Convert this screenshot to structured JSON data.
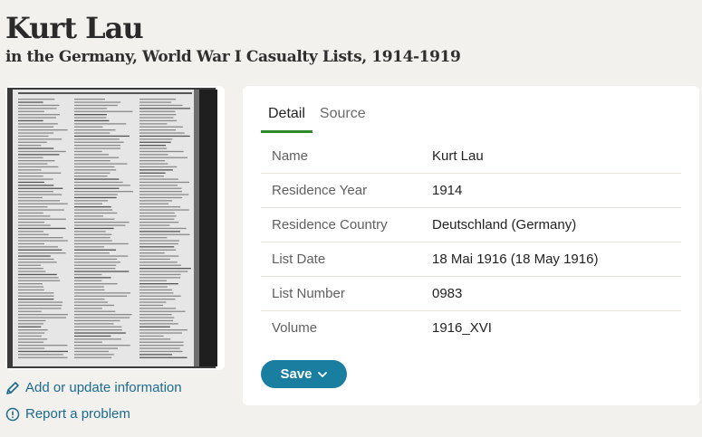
{
  "record": {
    "name": "Kurt Lau",
    "collection": "in the Germany, World War I Casualty Lists, 1914-1919"
  },
  "sidebar": {
    "add_update_label": "Add or update information",
    "report_label": "Report a problem"
  },
  "tabs": [
    {
      "label": "Detail",
      "active": true
    },
    {
      "label": "Source",
      "active": false
    }
  ],
  "details": [
    {
      "label": "Name",
      "value": "Kurt Lau"
    },
    {
      "label": "Residence Year",
      "value": "1914"
    },
    {
      "label": "Residence Country",
      "value": "Deutschland (Germany)"
    },
    {
      "label": "List Date",
      "value": "18 Mai 1916 (18 May 1916)"
    },
    {
      "label": "List Number",
      "value": "0983"
    },
    {
      "label": "Volume",
      "value": "1916_XVI"
    }
  ],
  "actions": {
    "save_label": "Save"
  },
  "icons": {
    "edit": "pencil-icon",
    "report": "alert-circle-icon",
    "save_menu": "chevron-down-icon"
  },
  "colors": {
    "link": "#1c6a8d",
    "save_button": "#1a7ea0",
    "active_tab_underline": "#2f8a2a",
    "background": "#f3f1ee"
  }
}
